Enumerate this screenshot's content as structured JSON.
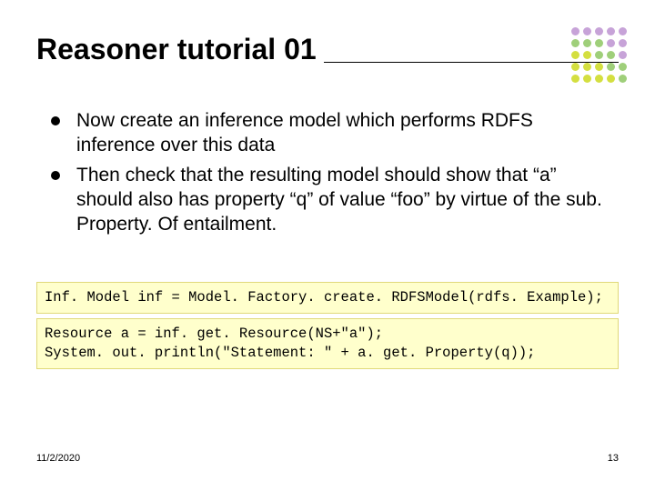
{
  "title": "Reasoner tutorial 01",
  "bullets": [
    "Now create an inference model which performs RDFS inference over this data",
    "Then check that the resulting model should show that “a” should also has property “q” of value “foo” by virtue of the sub. Property. Of entailment."
  ],
  "code1": "Inf. Model inf = Model. Factory. create. RDFSModel(rdfs. Example);",
  "code2": "Resource a = inf. get. Resource(NS+\"a\");\nSystem. out. println(\"Statement: \" + a. get. Property(q));",
  "footer": {
    "date": "11/2/2020",
    "page": "13"
  },
  "decor": {
    "dot_colors": [
      "#c7a3d8",
      "#c7a3d8",
      "#c7a3d8",
      "#c7a3d8",
      "#c7a3d8",
      "#9fcf7a",
      "#9fcf7a",
      "#9fcf7a",
      "#c7a3d8",
      "#c7a3d8",
      "#d4df40",
      "#d4df40",
      "#9fcf7a",
      "#9fcf7a",
      "#c7a3d8",
      "#d4df40",
      "#d4df40",
      "#d4df40",
      "#9fcf7a",
      "#9fcf7a",
      "#d4df40",
      "#d4df40",
      "#d4df40",
      "#d4df40",
      "#9fcf7a"
    ]
  }
}
